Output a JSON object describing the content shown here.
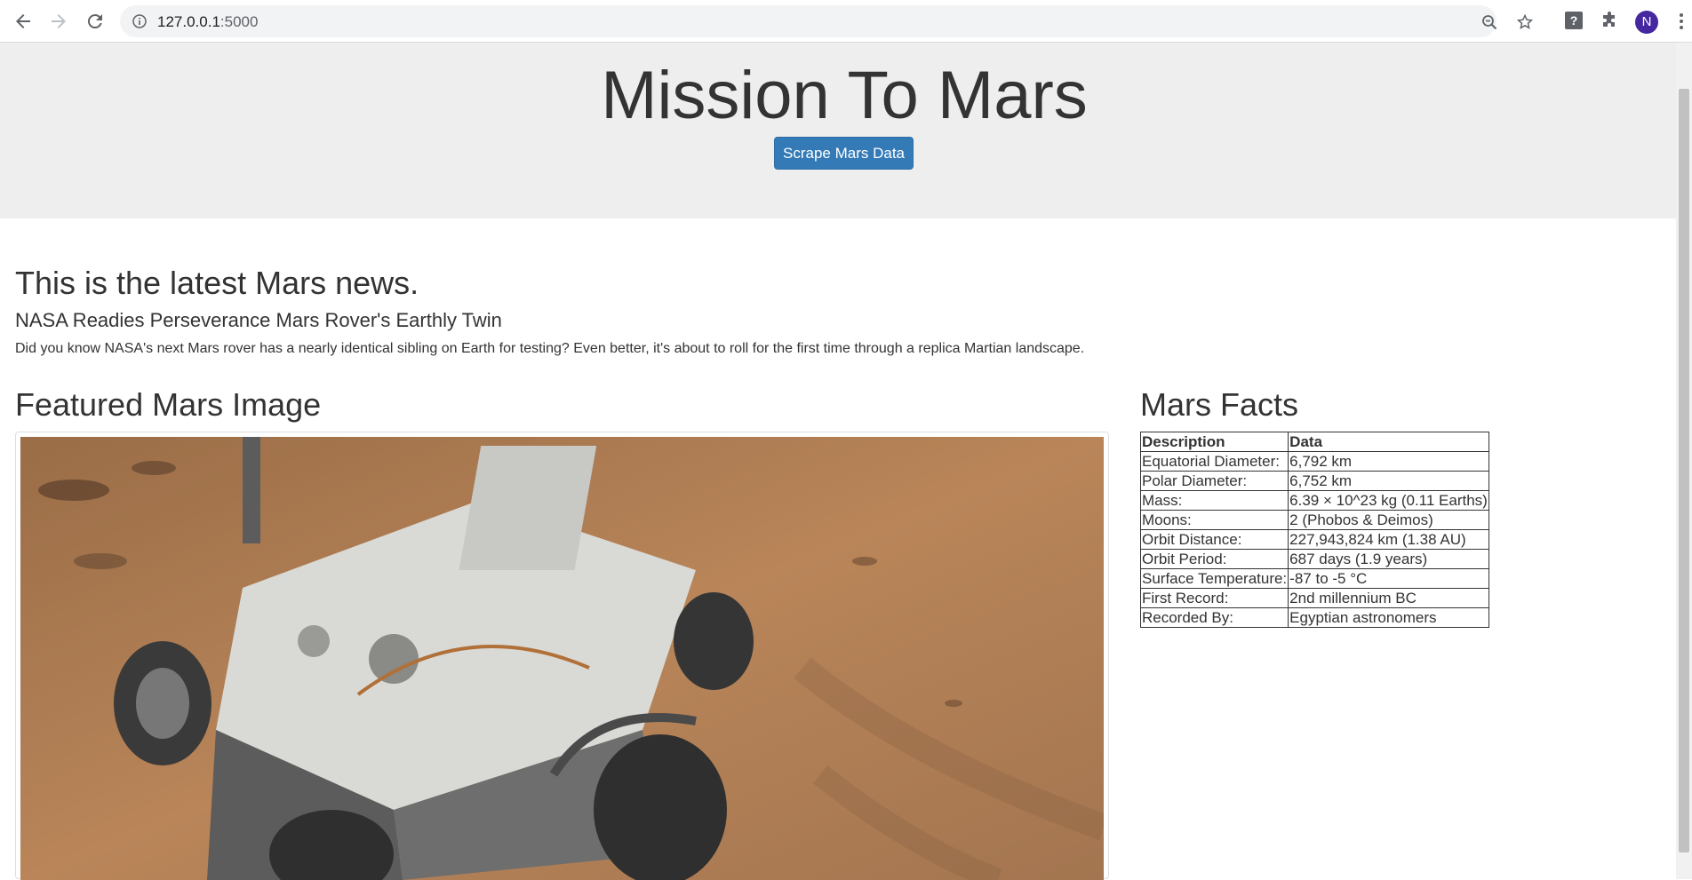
{
  "browser": {
    "url_host": "127.0.0.1",
    "url_port": ":5000",
    "avatar_initial": "N"
  },
  "jumbotron": {
    "title": "Mission To Mars",
    "button_label": "Scrape Mars Data"
  },
  "news": {
    "heading": "This is the latest Mars news.",
    "title": "NASA Readies Perseverance Mars Rover's Earthly Twin",
    "body": "Did you know NASA's next Mars rover has a nearly identical sibling on Earth for testing? Even better, it's about to roll for the first time through a replica Martian landscape."
  },
  "featured": {
    "heading": "Featured Mars Image"
  },
  "facts": {
    "heading": "Mars Facts",
    "columns": [
      "Description",
      "Data"
    ],
    "rows": [
      [
        "Equatorial Diameter:",
        "6,792 km"
      ],
      [
        "Polar Diameter:",
        "6,752 km"
      ],
      [
        "Mass:",
        "6.39 × 10^23 kg (0.11 Earths)"
      ],
      [
        "Moons:",
        "2 (Phobos & Deimos)"
      ],
      [
        "Orbit Distance:",
        "227,943,824 km (1.38 AU)"
      ],
      [
        "Orbit Period:",
        "687 days (1.9 years)"
      ],
      [
        "Surface Temperature:",
        "-87 to -5 °C"
      ],
      [
        "First Record:",
        "2nd millennium BC"
      ],
      [
        "Recorded By:",
        "Egyptian astronomers"
      ]
    ]
  },
  "colors": {
    "button_primary": "#337ab7",
    "jumbotron_bg": "#eeeeee",
    "avatar_bg": "#4527a0"
  }
}
